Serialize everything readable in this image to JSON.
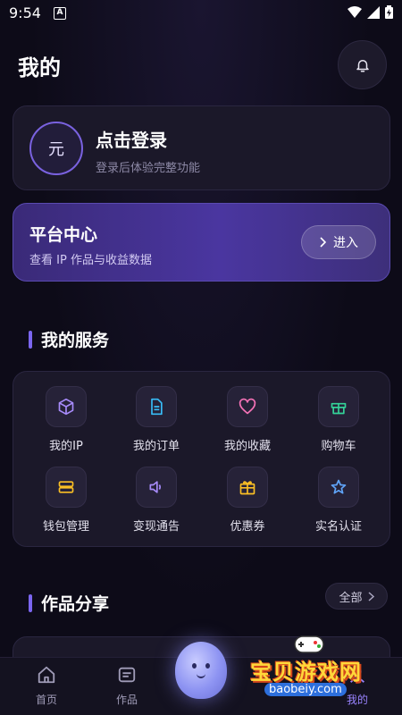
{
  "status_bar": {
    "time": "9:54",
    "notif_letter": "A"
  },
  "header": {
    "title": "我的"
  },
  "login": {
    "avatar_char": "元",
    "title": "点击登录",
    "subtitle": "登录后体验完整功能"
  },
  "platform": {
    "title": "平台中心",
    "subtitle": "查看 IP 作品与收益数据",
    "enter_label": "进入"
  },
  "services": {
    "title": "我的服务",
    "items": [
      {
        "label": "我的IP",
        "icon": "cube-icon",
        "color": "#a78bfa"
      },
      {
        "label": "我的订单",
        "icon": "document-icon",
        "color": "#38bdf8"
      },
      {
        "label": "我的收藏",
        "icon": "heart-icon",
        "color": "#f472b6"
      },
      {
        "label": "购物车",
        "icon": "gift-box-icon",
        "color": "#34d399"
      },
      {
        "label": "钱包管理",
        "icon": "wallet-icon",
        "color": "#fbbf24"
      },
      {
        "label": "变现通告",
        "icon": "speaker-icon",
        "color": "#a78bfa"
      },
      {
        "label": "优惠券",
        "icon": "gift-icon",
        "color": "#fbbf24"
      },
      {
        "label": "实名认证",
        "icon": "star-icon",
        "color": "#60a5fa"
      }
    ]
  },
  "works": {
    "title": "作品分享",
    "all_label": "全部"
  },
  "tabs": [
    {
      "label": "首页",
      "icon": "home-icon"
    },
    {
      "label": "作品",
      "icon": "works-icon"
    },
    {
      "label": "我的",
      "icon": "profile-icon"
    }
  ],
  "watermark": {
    "main": "宝贝游戏网",
    "url": "baobeiy.com"
  },
  "colors": {
    "accent": "#7b66f0",
    "background": "#0d0b18",
    "card": "#1b1829"
  }
}
